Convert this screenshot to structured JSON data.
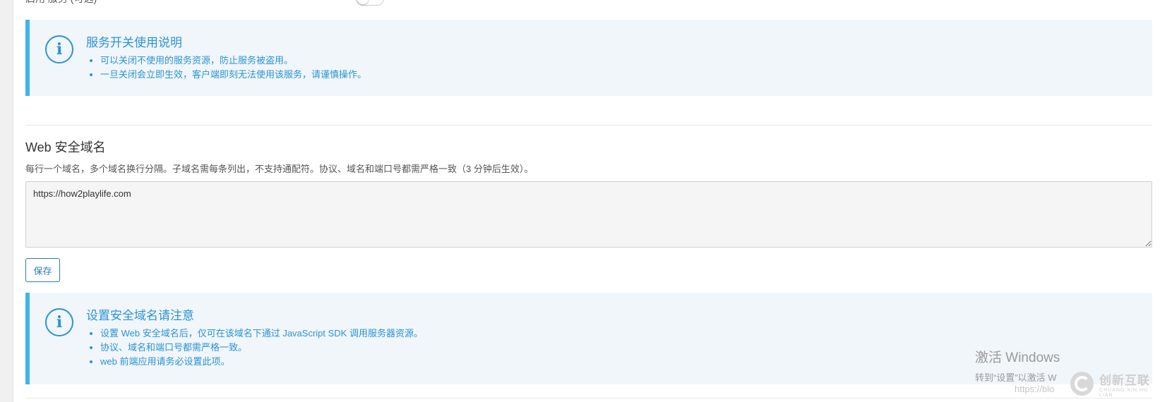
{
  "top_row": {
    "label": "启用 服务 (可选)"
  },
  "notice_switch": {
    "icon": "info-icon",
    "title": "服务开关使用说明",
    "items": [
      "可以关闭不使用的服务资源，防止服务被盗用。",
      "一旦关闭会立即生效，客户端即刻无法使用该服务，请谨慎操作。"
    ]
  },
  "web_domain": {
    "title": "Web 安全域名",
    "description": "每行一个域名，多个域名换行分隔。子域名需每条列出，不支持通配符。协议、域名和端口号都需严格一致（3 分钟后生效）。",
    "textarea_value": "https://how2playlife.com",
    "save_label": "保存"
  },
  "notice_domain": {
    "icon": "info-icon",
    "title": "设置安全域名请注意",
    "items": [
      "设置 Web 安全域名后，仅可在该域名下通过 JavaScript SDK 调用服务器资源。",
      "协议、域名和端口号都需严格一致。",
      "web 前端应用请务必设置此项。"
    ]
  },
  "watermark": {
    "title": "激活 Windows",
    "subtitle": "转到“设置”以激活 W",
    "url": "https://blo"
  },
  "brand": {
    "name": "创新互联",
    "sub": "CHUANG XIN HU LIAN"
  },
  "colors": {
    "accent": "#2a93d5",
    "notice_border": "#3eb6e8",
    "notice_bg": "#f1f6fb"
  }
}
